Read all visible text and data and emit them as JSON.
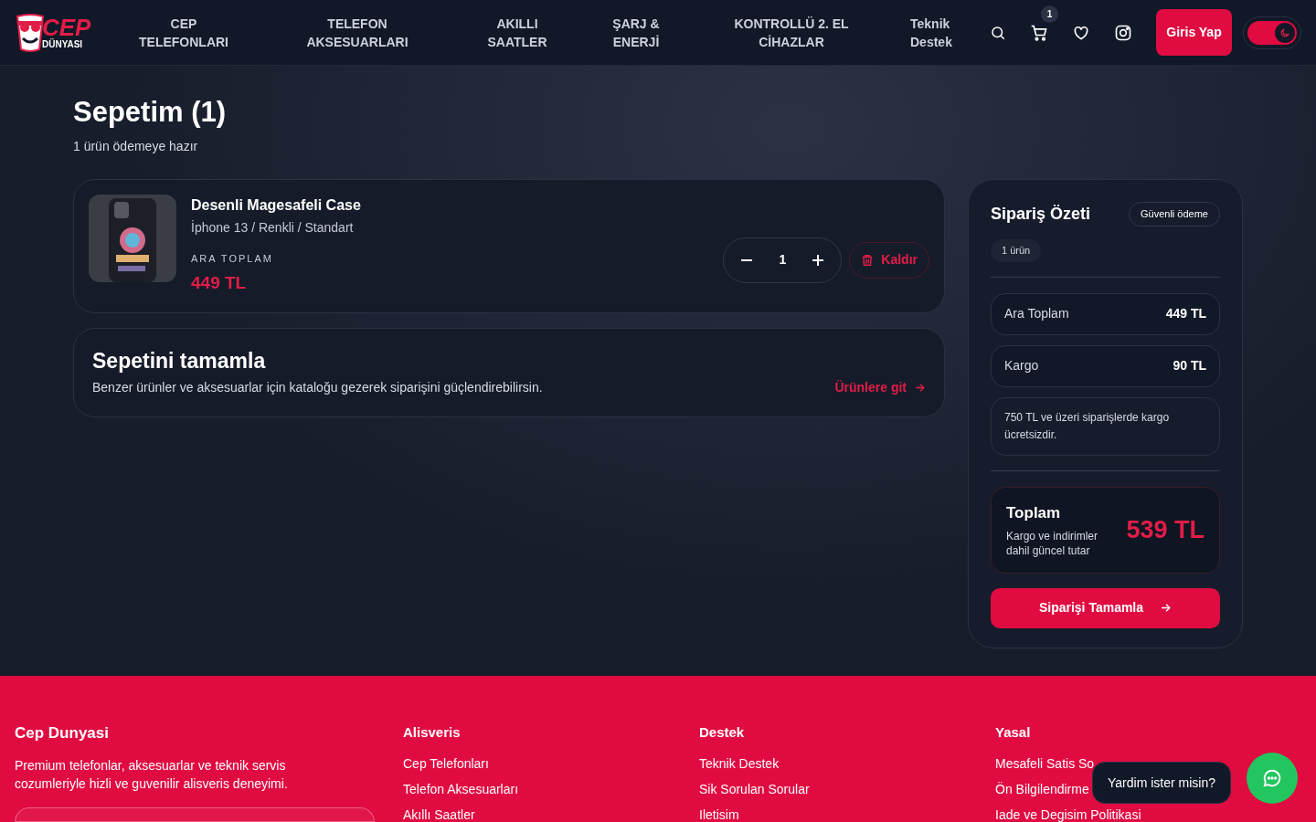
{
  "header": {
    "logo": {
      "word": "CEP",
      "sub": "DÜNYASI"
    },
    "nav": [
      {
        "label": "CEP TELEFONLARI",
        "kind": "caps"
      },
      {
        "label": "TELEFON AKSESUARLARI",
        "kind": "caps"
      },
      {
        "label": "AKILLI SAATLER",
        "kind": "caps"
      },
      {
        "label": "ŞARJ & ENERJİ",
        "kind": "caps"
      },
      {
        "label": "KONTROLLÜ 2. EL CİHAZLAR",
        "kind": "caps"
      },
      {
        "label": "Teknik Destek",
        "kind": "plain"
      }
    ],
    "cart_count": "1",
    "login": "Giris Yap",
    "dark_mode": {
      "on": true
    }
  },
  "page": {
    "title": "Sepetim (1)",
    "subtitle": "1 ürün ödemeye hazır"
  },
  "cart_items": [
    {
      "name": "Desenli Magesafeli Case",
      "variant": "İphone 13 / Renkli / Standart",
      "subtotal_label": "ARA TOPLAM",
      "price": "449 TL",
      "quantity": "1",
      "remove": "Kaldır"
    }
  ],
  "complete_cart": {
    "title": "Sepetini tamamla",
    "text": "Benzer ürünler ve aksesuarlar için kataloğu gezerek siparişini güçlendirebilirsin.",
    "link": "Ürünlere git"
  },
  "summary": {
    "title": "Sipariş Özeti",
    "badge": "Güvenli ödeme",
    "count": "1 ürün",
    "lines": [
      {
        "label": "Ara Toplam",
        "value": "449 TL"
      },
      {
        "label": "Kargo",
        "value": "90 TL"
      }
    ],
    "note": "750 TL ve üzeri siparişlerde kargo ücretsizdir.",
    "total_label": "Toplam",
    "total_hint": "Kargo ve indirimler dahil güncel tutar",
    "total": "539 TL",
    "checkout": "Siparişi Tamamla"
  },
  "footer": {
    "brand": "Cep Dunyasi",
    "about": "Premium telefonlar, aksesuarlar ve teknik servis cozumleriyle hizli ve guvenilir alisveris deneyimi.",
    "columns": [
      {
        "title": "Alisveris",
        "links": [
          "Cep Telefonları",
          "Telefon Aksesuarları",
          "Akıllı Saatler"
        ]
      },
      {
        "title": "Destek",
        "links": [
          "Teknik Destek",
          "Sik Sorulan Sorular",
          "Iletisim"
        ]
      },
      {
        "title": "Yasal",
        "links": [
          "Mesafeli Satis So",
          "Ön Bilgilendirme",
          "Iade ve Degisim Politikasi"
        ]
      }
    ]
  },
  "help_bubble": "Yardim ister misin?"
}
